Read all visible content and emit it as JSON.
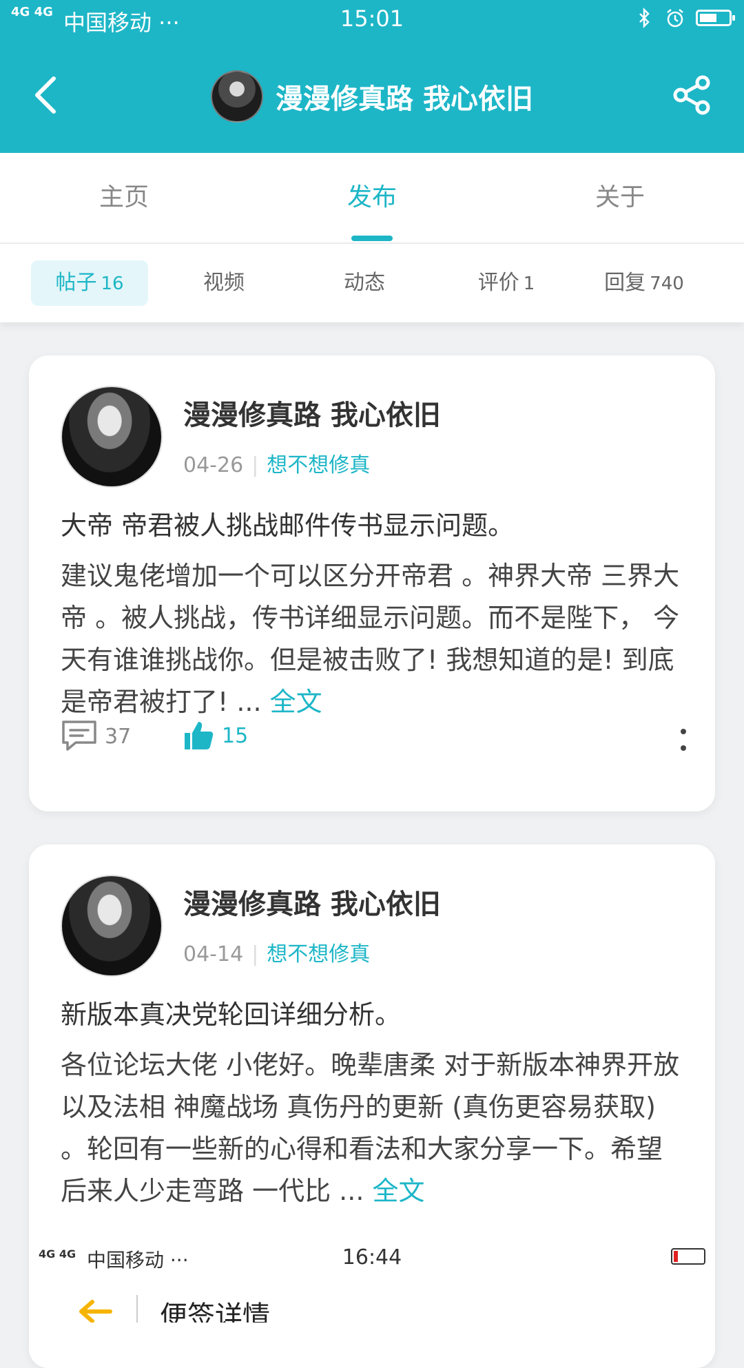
{
  "status_bar": {
    "network": "4G 4G",
    "carrier": "中国移动 ···",
    "time": "15:01",
    "battery_level": 0.6
  },
  "header": {
    "title": "漫漫修真路 我心依旧",
    "back_icon": "chevron-left-icon",
    "share_icon": "share-icon"
  },
  "main_tabs": [
    {
      "label": "主页",
      "active": false
    },
    {
      "label": "发布",
      "active": true
    },
    {
      "label": "关于",
      "active": false
    }
  ],
  "sub_tabs": [
    {
      "label": "帖子",
      "count": "16",
      "active": true
    },
    {
      "label": "视频",
      "count": "",
      "active": false
    },
    {
      "label": "动态",
      "count": "",
      "active": false
    },
    {
      "label": "评价",
      "count": "1",
      "active": false
    },
    {
      "label": "回复",
      "count": "740",
      "active": false
    }
  ],
  "posts": [
    {
      "author": "漫漫修真路 我心依旧",
      "date": "04-26",
      "forum": "想不想修真",
      "title": "大帝 帝君被人挑战邮件传书显示问题。",
      "body": "建议鬼佬增加一个可以区分开帝君 。神界大帝 三界大帝 。被人挑战，传书详细显示问题。而不是陛下， 今天有谁谁挑战你。但是被击败了! 我想知道的是!  到底是帝君被打了!   ...",
      "more_label": "全文",
      "comments": "37",
      "likes": "15"
    },
    {
      "author": "漫漫修真路 我心依旧",
      "date": "04-14",
      "forum": "想不想修真",
      "title": "新版本真决党轮回详细分析。",
      "body": "各位论坛大佬 小佬好。晚辈唐柔 对于新版本神界开放 以及法相 神魔战场 真伤丹的更新 (真伤更容易获取) 。轮回有一些新的心得和看法和大家分享一下。希望后来人少走弯路 一代比 ...",
      "more_label": "全文"
    }
  ],
  "embedded_screenshot": {
    "network": "4G 4G",
    "carrier": "中国移动 ···",
    "time": "16:44",
    "title": "便签详情",
    "battery_level": 0.15,
    "battery_color": "#e02020"
  },
  "colors": {
    "accent": "#1db6c7",
    "background": "#f0f1f3"
  }
}
